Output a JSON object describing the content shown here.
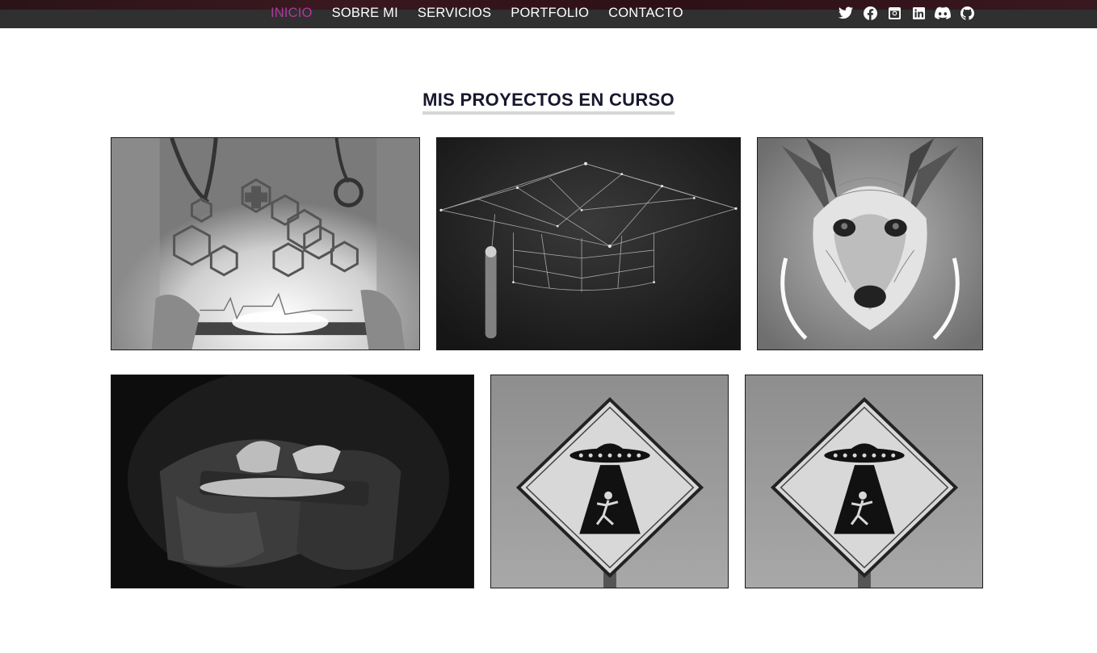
{
  "nav": {
    "items": [
      {
        "label": "INICIO",
        "active": true
      },
      {
        "label": "SOBRE MI",
        "active": false
      },
      {
        "label": "SERVICIOS",
        "active": false
      },
      {
        "label": "PORTFOLIO",
        "active": false
      },
      {
        "label": "CONTACTO",
        "active": false
      }
    ],
    "social_icons": [
      "twitter-icon",
      "facebook-icon",
      "instagram-icon",
      "linkedin-icon",
      "discord-icon",
      "github-icon"
    ],
    "active_color": "#b0389a"
  },
  "section": {
    "title": "MIS PROYECTOS EN CURSO"
  },
  "projects": [
    {
      "image": "doctor-tablet-health-icons"
    },
    {
      "image": "graduation-cap-network"
    },
    {
      "image": "ornate-dog-portrait"
    },
    {
      "image": "hands-holding-phone"
    },
    {
      "image": "ufo-warning-sign"
    },
    {
      "image": "ufo-warning-sign"
    }
  ]
}
